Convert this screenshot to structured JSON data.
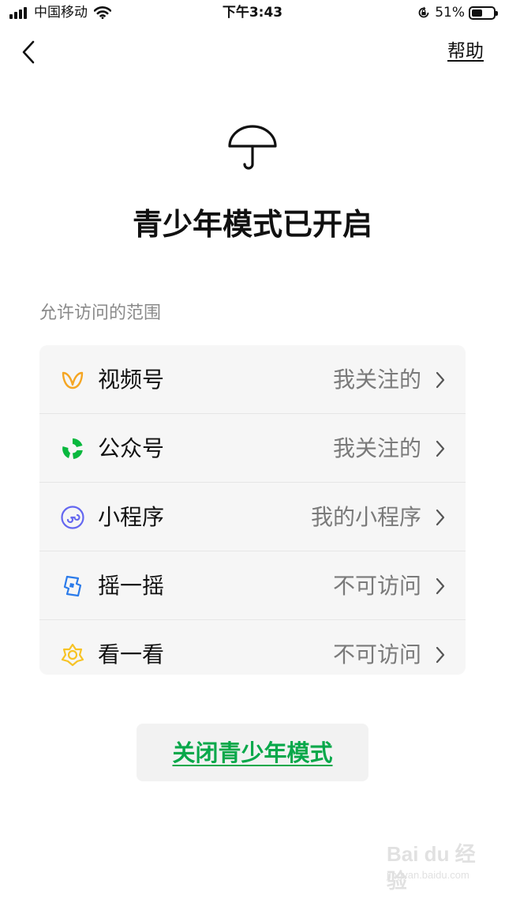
{
  "status_bar": {
    "carrier": "中国移动",
    "time": "下午3:43",
    "battery_percent": "51%",
    "battery_level": 0.51
  },
  "nav": {
    "back_icon": "chevron-left-icon",
    "help_label": "帮助"
  },
  "hero": {
    "icon": "umbrella-icon",
    "title": "青少年模式已开启"
  },
  "section": {
    "label": "允许访问的范围"
  },
  "items": [
    {
      "icon": "channels-icon",
      "label": "视频号",
      "value": "我关注的",
      "icon_color": "#f5a623"
    },
    {
      "icon": "official-accounts-icon",
      "label": "公众号",
      "value": "我关注的",
      "icon_color": "#09b83e"
    },
    {
      "icon": "mini-program-icon",
      "label": "小程序",
      "value": "我的小程序",
      "icon_color": "#6467f0"
    },
    {
      "icon": "shake-icon",
      "label": "摇一摇",
      "value": "不可访问",
      "icon_color": "#2b7bea"
    },
    {
      "icon": "top-stories-icon",
      "label": "看一看",
      "value": "不可访问",
      "icon_color": "#f7c325"
    }
  ],
  "actions": {
    "close_label": "关闭青少年模式"
  },
  "colors": {
    "accent_green": "#08a84a",
    "card_background": "#f6f6f6",
    "secondary_text": "#7a7a7a"
  },
  "watermark": {
    "main": "Bai du 经验",
    "sub": "jingyan.baidu.com"
  }
}
